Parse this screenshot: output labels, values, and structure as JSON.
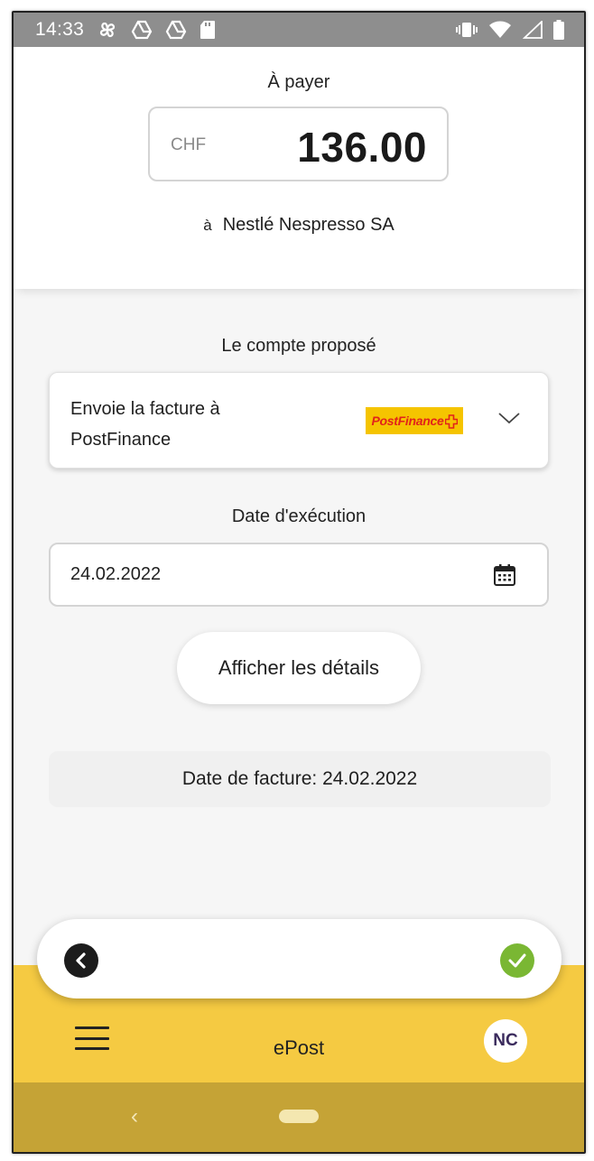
{
  "status_bar": {
    "time": "14:33",
    "left_icons": [
      "pinwheel-icon",
      "drive-icon",
      "drive-icon",
      "sd-card-icon"
    ],
    "right_icons": [
      "vibrate-icon",
      "wifi-icon",
      "signal-icon",
      "battery-icon"
    ]
  },
  "payment": {
    "label": "À payer",
    "currency": "CHF",
    "amount": "136.00",
    "payee_prefix": "à",
    "payee": "Nestlé Nespresso SA"
  },
  "account": {
    "label": "Le compte proposé",
    "value_line1": "Envoie la facture à",
    "value_line2": "PostFinance",
    "logo_text": "PostFinance"
  },
  "execution": {
    "label": "Date d'exécution",
    "date": "24.02.2022"
  },
  "details_button": "Afficher les détails",
  "invoice_date": "Date de facture: 24.02.2022",
  "bottom_bar": {
    "title": "ePost",
    "avatar_initials": "NC"
  },
  "colors": {
    "accent_yellow": "#f5ca42",
    "nav_bar": "#c5a336",
    "confirm_green": "#7ab733",
    "postfinance_yellow": "#f5c400"
  }
}
